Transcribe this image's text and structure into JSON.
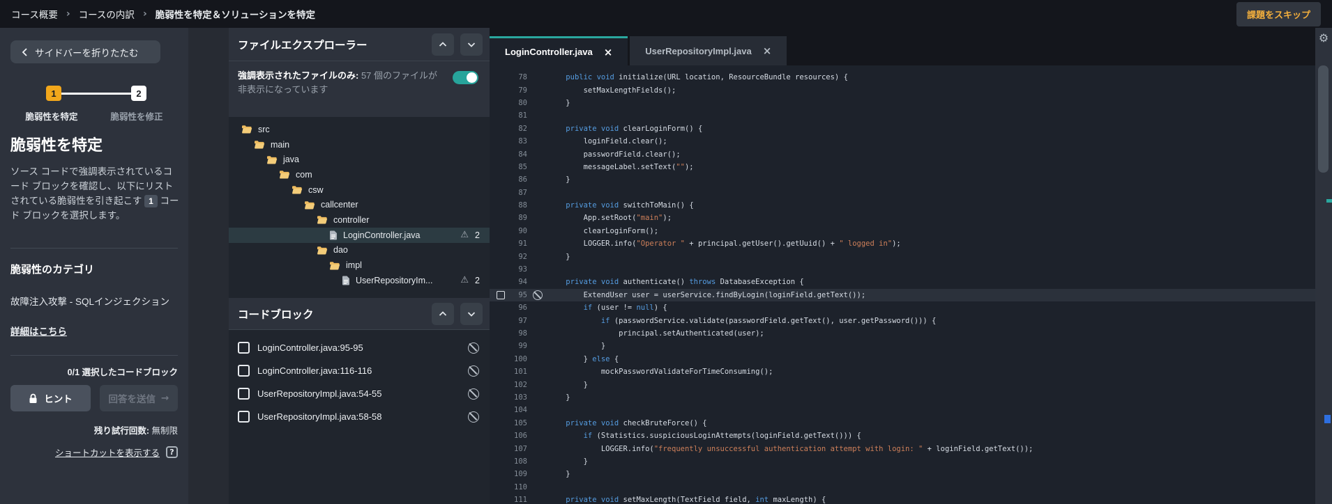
{
  "topbar": {
    "breadcrumb": [
      "コース概要",
      "コースの内訳",
      "脆弱性を特定＆ソリューションを特定"
    ],
    "separator": "›",
    "skip_label": "課題をスキップ"
  },
  "sidebar": {
    "collapse_label": "サイドバーを折りたたむ",
    "steps": [
      {
        "num": "1",
        "label": "脆弱性を特定",
        "active": true
      },
      {
        "num": "2",
        "label": "脆弱性を修正",
        "active": false
      }
    ],
    "title": "脆弱性を特定",
    "description_before": "ソース コードで強調表示されているコード ブロックを確認し、以下にリストされている脆弱性を引き起こす ",
    "description_badge": "1",
    "description_after": " コード ブロックを選択します。",
    "category_heading": "脆弱性のカテゴリ",
    "category_value": "故障注入攻撃 - SQLインジェクション",
    "details_link": "詳細はこちら",
    "selected_count": "0/1 選択したコードブロック",
    "hint_label": "ヒント",
    "submit_label": "回答を送信",
    "submit_arrow": "→",
    "attempts_label": "残り試行回数:",
    "attempts_value": "無制限",
    "shortcuts_link": "ショートカットを表示する",
    "help_glyph": "?"
  },
  "explorer": {
    "title": "ファイルエクスプローラー",
    "toggle_label_bold": "強調表示されたファイルのみ:",
    "toggle_label_rest": " 57 個のファイルが非表示になっています",
    "toggle_on": true,
    "tree": [
      {
        "name": "src",
        "depth": 0,
        "type": "folder"
      },
      {
        "name": "main",
        "depth": 1,
        "type": "folder"
      },
      {
        "name": "java",
        "depth": 2,
        "type": "folder"
      },
      {
        "name": "com",
        "depth": 3,
        "type": "folder"
      },
      {
        "name": "csw",
        "depth": 4,
        "type": "folder"
      },
      {
        "name": "callcenter",
        "depth": 5,
        "type": "folder"
      },
      {
        "name": "controller",
        "depth": 6,
        "type": "folder"
      },
      {
        "name": "LoginController.java",
        "depth": 7,
        "type": "file",
        "selected": true,
        "warnings": "2"
      },
      {
        "name": "dao",
        "depth": 6,
        "type": "folder"
      },
      {
        "name": "impl",
        "depth": 7,
        "type": "folder"
      },
      {
        "name": "UserRepositoryIm...",
        "depth": 8,
        "type": "file",
        "warnings": "2"
      }
    ],
    "warning_glyph": "⚠",
    "codeblock_title": "コードブロック",
    "blocks": [
      {
        "label": "LoginController.java:95-95"
      },
      {
        "label": "LoginController.java:116-116"
      },
      {
        "label": "UserRepositoryImpl.java:54-55"
      },
      {
        "label": "UserRepositoryImpl.java:58-58"
      }
    ]
  },
  "editor": {
    "tabs": [
      {
        "label": "LoginController.java",
        "active": true
      },
      {
        "label": "UserRepositoryImpl.java",
        "active": false
      }
    ],
    "close_glyph": "×",
    "code_lines": [
      {
        "n": 78,
        "seg": [
          [
            "    ",
            "p"
          ],
          [
            "public",
            "k"
          ],
          [
            " ",
            "p"
          ],
          [
            "void",
            "k"
          ],
          [
            " initialize(URL location, ResourceBundle resources) {",
            "p"
          ]
        ]
      },
      {
        "n": 79,
        "seg": [
          [
            "        setMaxLengthFields();",
            "p"
          ]
        ]
      },
      {
        "n": 80,
        "seg": [
          [
            "    }",
            "p"
          ]
        ]
      },
      {
        "n": 81,
        "seg": []
      },
      {
        "n": 82,
        "seg": [
          [
            "    ",
            "p"
          ],
          [
            "private",
            "k"
          ],
          [
            " ",
            "p"
          ],
          [
            "void",
            "k"
          ],
          [
            " clearLoginForm() {",
            "p"
          ]
        ]
      },
      {
        "n": 83,
        "seg": [
          [
            "        loginField.clear();",
            "p"
          ]
        ]
      },
      {
        "n": 84,
        "seg": [
          [
            "        passwordField.clear();",
            "p"
          ]
        ]
      },
      {
        "n": 85,
        "seg": [
          [
            "        messageLabel.setText(",
            "p"
          ],
          [
            "\"\"",
            "s"
          ],
          [
            ");",
            "p"
          ]
        ]
      },
      {
        "n": 86,
        "seg": [
          [
            "    }",
            "p"
          ]
        ]
      },
      {
        "n": 87,
        "seg": []
      },
      {
        "n": 88,
        "seg": [
          [
            "    ",
            "p"
          ],
          [
            "private",
            "k"
          ],
          [
            " ",
            "p"
          ],
          [
            "void",
            "k"
          ],
          [
            " switchToMain() {",
            "p"
          ]
        ]
      },
      {
        "n": 89,
        "seg": [
          [
            "        App.setRoot(",
            "p"
          ],
          [
            "\"main\"",
            "s"
          ],
          [
            ");",
            "p"
          ]
        ]
      },
      {
        "n": 90,
        "seg": [
          [
            "        clearLoginForm();",
            "p"
          ]
        ]
      },
      {
        "n": 91,
        "seg": [
          [
            "        LOGGER.info(",
            "p"
          ],
          [
            "\"Operator \"",
            "s"
          ],
          [
            " + principal.getUser().getUuid() + ",
            "p"
          ],
          [
            "\" logged in\"",
            "s"
          ],
          [
            ");",
            "p"
          ]
        ]
      },
      {
        "n": 92,
        "seg": [
          [
            "    }",
            "p"
          ]
        ]
      },
      {
        "n": 93,
        "seg": []
      },
      {
        "n": 94,
        "seg": [
          [
            "    ",
            "p"
          ],
          [
            "private",
            "k"
          ],
          [
            " ",
            "p"
          ],
          [
            "void",
            "k"
          ],
          [
            " authenticate() ",
            "p"
          ],
          [
            "throws",
            "k"
          ],
          [
            " DatabaseException {",
            "p"
          ]
        ]
      },
      {
        "n": 95,
        "marked": true,
        "seg": [
          [
            "        ExtendUser user = userService.findByLogin(loginField.getText());",
            "p"
          ]
        ]
      },
      {
        "n": 96,
        "seg": [
          [
            "        ",
            "p"
          ],
          [
            "if",
            "k"
          ],
          [
            " (user != ",
            "p"
          ],
          [
            "null",
            "k"
          ],
          [
            ") {",
            "p"
          ]
        ]
      },
      {
        "n": 97,
        "seg": [
          [
            "            ",
            "p"
          ],
          [
            "if",
            "k"
          ],
          [
            " (passwordService.validate(passwordField.getText(), user.getPassword())) {",
            "p"
          ]
        ]
      },
      {
        "n": 98,
        "seg": [
          [
            "                principal.setAuthenticated(user);",
            "p"
          ]
        ]
      },
      {
        "n": 99,
        "seg": [
          [
            "            }",
            "p"
          ]
        ]
      },
      {
        "n": 100,
        "seg": [
          [
            "        } ",
            "p"
          ],
          [
            "else",
            "k"
          ],
          [
            " {",
            "p"
          ]
        ]
      },
      {
        "n": 101,
        "seg": [
          [
            "            mockPasswordValidateForTimeConsuming();",
            "p"
          ]
        ]
      },
      {
        "n": 102,
        "seg": [
          [
            "        }",
            "p"
          ]
        ]
      },
      {
        "n": 103,
        "seg": [
          [
            "    }",
            "p"
          ]
        ]
      },
      {
        "n": 104,
        "seg": []
      },
      {
        "n": 105,
        "seg": [
          [
            "    ",
            "p"
          ],
          [
            "private",
            "k"
          ],
          [
            " ",
            "p"
          ],
          [
            "void",
            "k"
          ],
          [
            " checkBruteForce() {",
            "p"
          ]
        ]
      },
      {
        "n": 106,
        "seg": [
          [
            "        ",
            "p"
          ],
          [
            "if",
            "k"
          ],
          [
            " (Statistics.suspiciousLoginAttempts(loginField.getText())) {",
            "p"
          ]
        ]
      },
      {
        "n": 107,
        "seg": [
          [
            "            LOGGER.info(",
            "p"
          ],
          [
            "\"frequently unsuccessful authentication attempt with login: \"",
            "s"
          ],
          [
            " + loginField.getText());",
            "p"
          ]
        ]
      },
      {
        "n": 108,
        "seg": [
          [
            "        }",
            "p"
          ]
        ]
      },
      {
        "n": 109,
        "seg": [
          [
            "    }",
            "p"
          ]
        ]
      },
      {
        "n": 110,
        "seg": []
      },
      {
        "n": 111,
        "seg": [
          [
            "    ",
            "p"
          ],
          [
            "private",
            "k"
          ],
          [
            " ",
            "p"
          ],
          [
            "void",
            "k"
          ],
          [
            " setMaxLength(TextField field, ",
            "p"
          ],
          [
            "int",
            "k"
          ],
          [
            " maxLength) {",
            "p"
          ]
        ]
      }
    ]
  },
  "colors": {
    "accent_yellow": "#f2a71b",
    "accent_teal": "#27a49b",
    "keyword_blue": "#559ce0",
    "string_orange": "#cd7f59",
    "editor_bg": "#1d222b",
    "panel_bg": "#2d323c",
    "topbar_bg": "#14161c",
    "scroll_marker_blue": "#2e6fe0"
  }
}
